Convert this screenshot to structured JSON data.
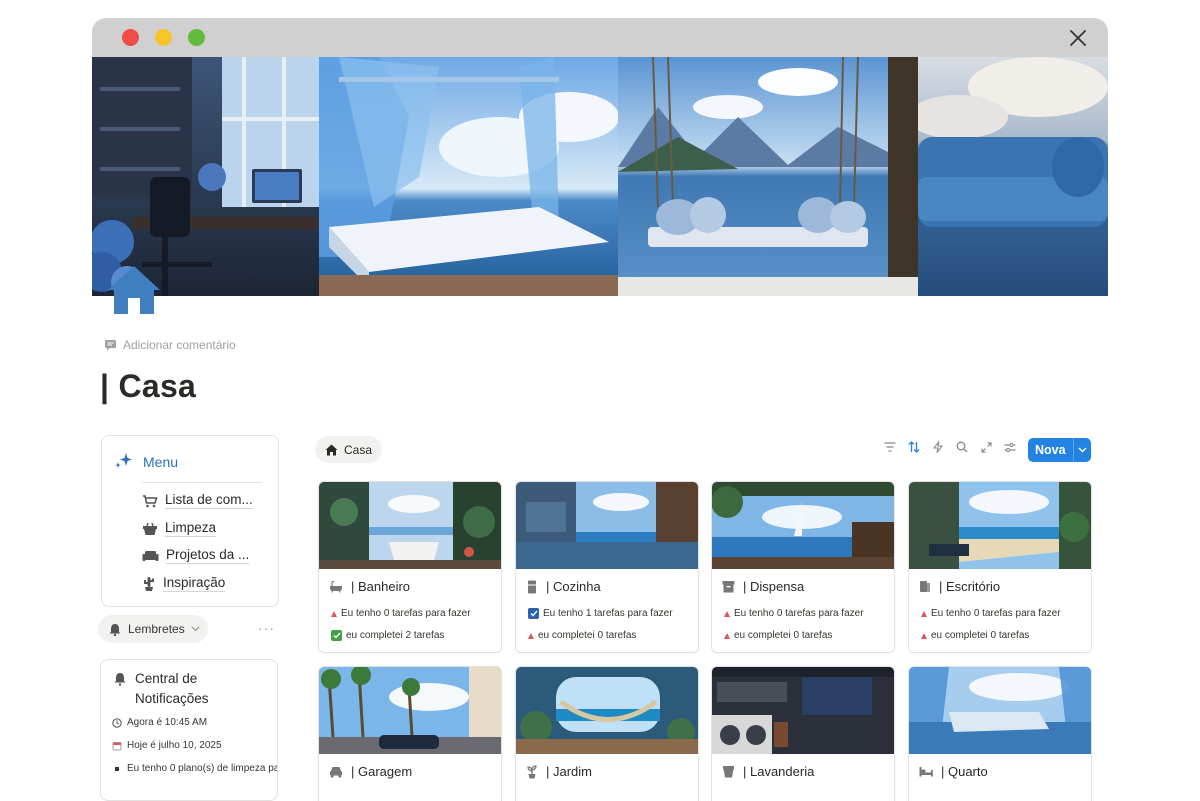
{
  "window": {
    "colors": {
      "close": "#ee4c48",
      "minimize": "#f5c52b",
      "zoom": "#63bb3d",
      "titlebar": "#d0d0d0"
    }
  },
  "page": {
    "add_comment": "Adicionar comentário",
    "title": "| Casa"
  },
  "menu": {
    "title": "Menu",
    "items": [
      {
        "label": "Lista de com...",
        "icon": "cart-icon"
      },
      {
        "label": "Limpeza",
        "icon": "basket-icon"
      },
      {
        "label": "Projetos da ...",
        "icon": "sofa-icon"
      },
      {
        "label": "Inspiração",
        "icon": "cactus-icon"
      }
    ]
  },
  "reminders": {
    "label": "Lembretes",
    "more": "···"
  },
  "notifications": {
    "title": "Central de Notificações",
    "rows": [
      {
        "text": "Agora é 10:45 AM",
        "icon": "clock-icon"
      },
      {
        "text": "Hoje é julho 10, 2025",
        "icon": "calendar-icon"
      },
      {
        "text": "Eu tenho 0 plano(s) de limpeza pa",
        "icon": "bullet-icon"
      }
    ]
  },
  "board": {
    "breadcrumb": "Casa",
    "new_button": "Nova",
    "accent": "#2383e2",
    "cards": [
      {
        "title": "| Banheiro",
        "icon": "bathtub-icon",
        "line1": "Eu tenho 0 tarefas para fazer",
        "line1_status": "pending",
        "line2": "eu completei 2 tarefas",
        "line2_status": "done"
      },
      {
        "title": "| Cozinha",
        "icon": "fridge-icon",
        "line1": "Eu tenho 1 tarefas para fazer",
        "line1_status": "checked",
        "line2": "eu completei 0 tarefas",
        "line2_status": "pending"
      },
      {
        "title": "| Dispensa",
        "icon": "box-icon",
        "line1": "Eu tenho 0 tarefas para fazer",
        "line1_status": "pending",
        "line2": "eu completei 0 tarefas",
        "line2_status": "pending"
      },
      {
        "title": "| Escritório",
        "icon": "books-icon",
        "line1": "Eu tenho 0 tarefas para fazer",
        "line1_status": "pending",
        "line2": "eu completei 0 tarefas",
        "line2_status": "pending"
      },
      {
        "title": "| Garagem",
        "icon": "car-icon"
      },
      {
        "title": "| Jardim",
        "icon": "plant-icon"
      },
      {
        "title": "| Lavanderia",
        "icon": "washer-icon"
      },
      {
        "title": "| Quarto",
        "icon": "bed-icon"
      }
    ]
  }
}
